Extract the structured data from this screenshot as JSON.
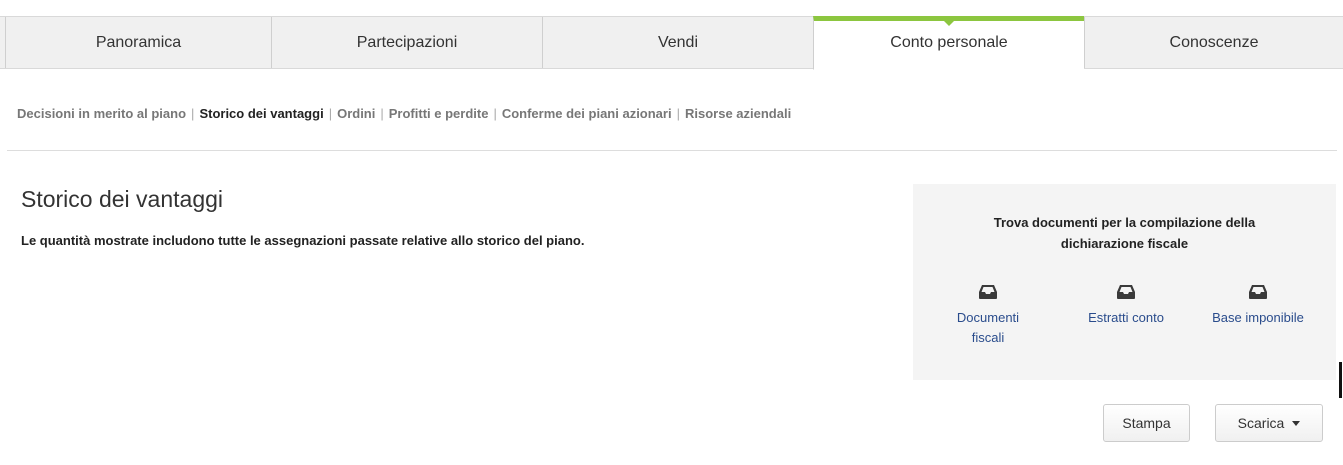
{
  "tabs": [
    {
      "label": "Panoramica"
    },
    {
      "label": "Partecipazioni"
    },
    {
      "label": "Vendi"
    },
    {
      "label": "Conto personale"
    },
    {
      "label": "Conoscenze"
    }
  ],
  "active_tab": "Conto personale",
  "subnav": [
    {
      "label": "Decisioni in merito al piano"
    },
    {
      "label": "Storico dei vantaggi"
    },
    {
      "label": "Ordini"
    },
    {
      "label": "Profitti e perdite"
    },
    {
      "label": "Conferme dei piani azionari"
    },
    {
      "label": "Risorse aziendali"
    }
  ],
  "active_subnav": "Storico dei vantaggi",
  "page": {
    "title": "Storico dei vantaggi",
    "description": "Le quantità mostrate includono tutte le assegnazioni passate relative allo storico del piano."
  },
  "panel": {
    "heading": "Trova documenti per la compilazione della dichiarazione fiscale",
    "links": [
      {
        "label": "Documenti fiscali",
        "icon": "inbox-icon"
      },
      {
        "label": "Estratti conto",
        "icon": "inbox-icon"
      },
      {
        "label": "Base imponibile",
        "icon": "inbox-icon"
      }
    ]
  },
  "buttons": {
    "print_label": "Stampa",
    "download_label": "Scarica"
  },
  "colors": {
    "accent": "#8cc63f",
    "link": "#2a4c8c",
    "panel_bg": "#f4f4f4"
  }
}
